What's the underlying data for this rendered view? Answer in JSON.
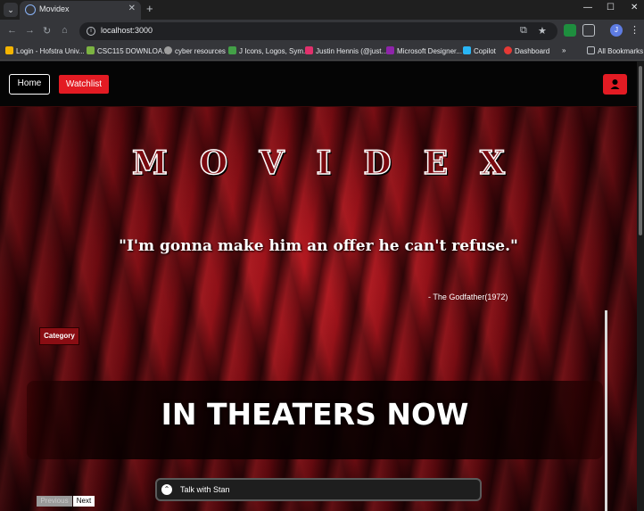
{
  "browser": {
    "tab_title": "Movidex",
    "url": "localhost:3000",
    "bookmarks": [
      {
        "label": "Login - Hofstra Univ...",
        "color": "#f4b400"
      },
      {
        "label": "CSC115 DOWNLOA...",
        "color": "#7cb342"
      },
      {
        "label": "cyber resources",
        "color": "#9e9e9e"
      },
      {
        "label": "J Icons, Logos, Sym...",
        "color": "#43a047"
      },
      {
        "label": "Justin Hennis (@just...",
        "color": "#e1306c"
      },
      {
        "label": "Microsoft Designer...",
        "color": "#8e24aa"
      },
      {
        "label": "Copilot",
        "color": "#29b6f6"
      },
      {
        "label": "Dashboard",
        "color": "#e53935"
      }
    ],
    "all_bookmarks": "All Bookmarks"
  },
  "nav": {
    "home": "Home",
    "watchlist": "Watchlist"
  },
  "hero": {
    "title": "MOVIDEX",
    "quote": "\"I'm gonna make him an offer he can't refuse.\"",
    "attribution": "- The Godfather(1972)",
    "category": "Category",
    "banner": "IN THEATERS NOW",
    "prev": "Previous",
    "next": "Next",
    "chat": "Talk with Stan"
  },
  "colors": {
    "accent": "#e31b23",
    "dark": "#050505"
  }
}
